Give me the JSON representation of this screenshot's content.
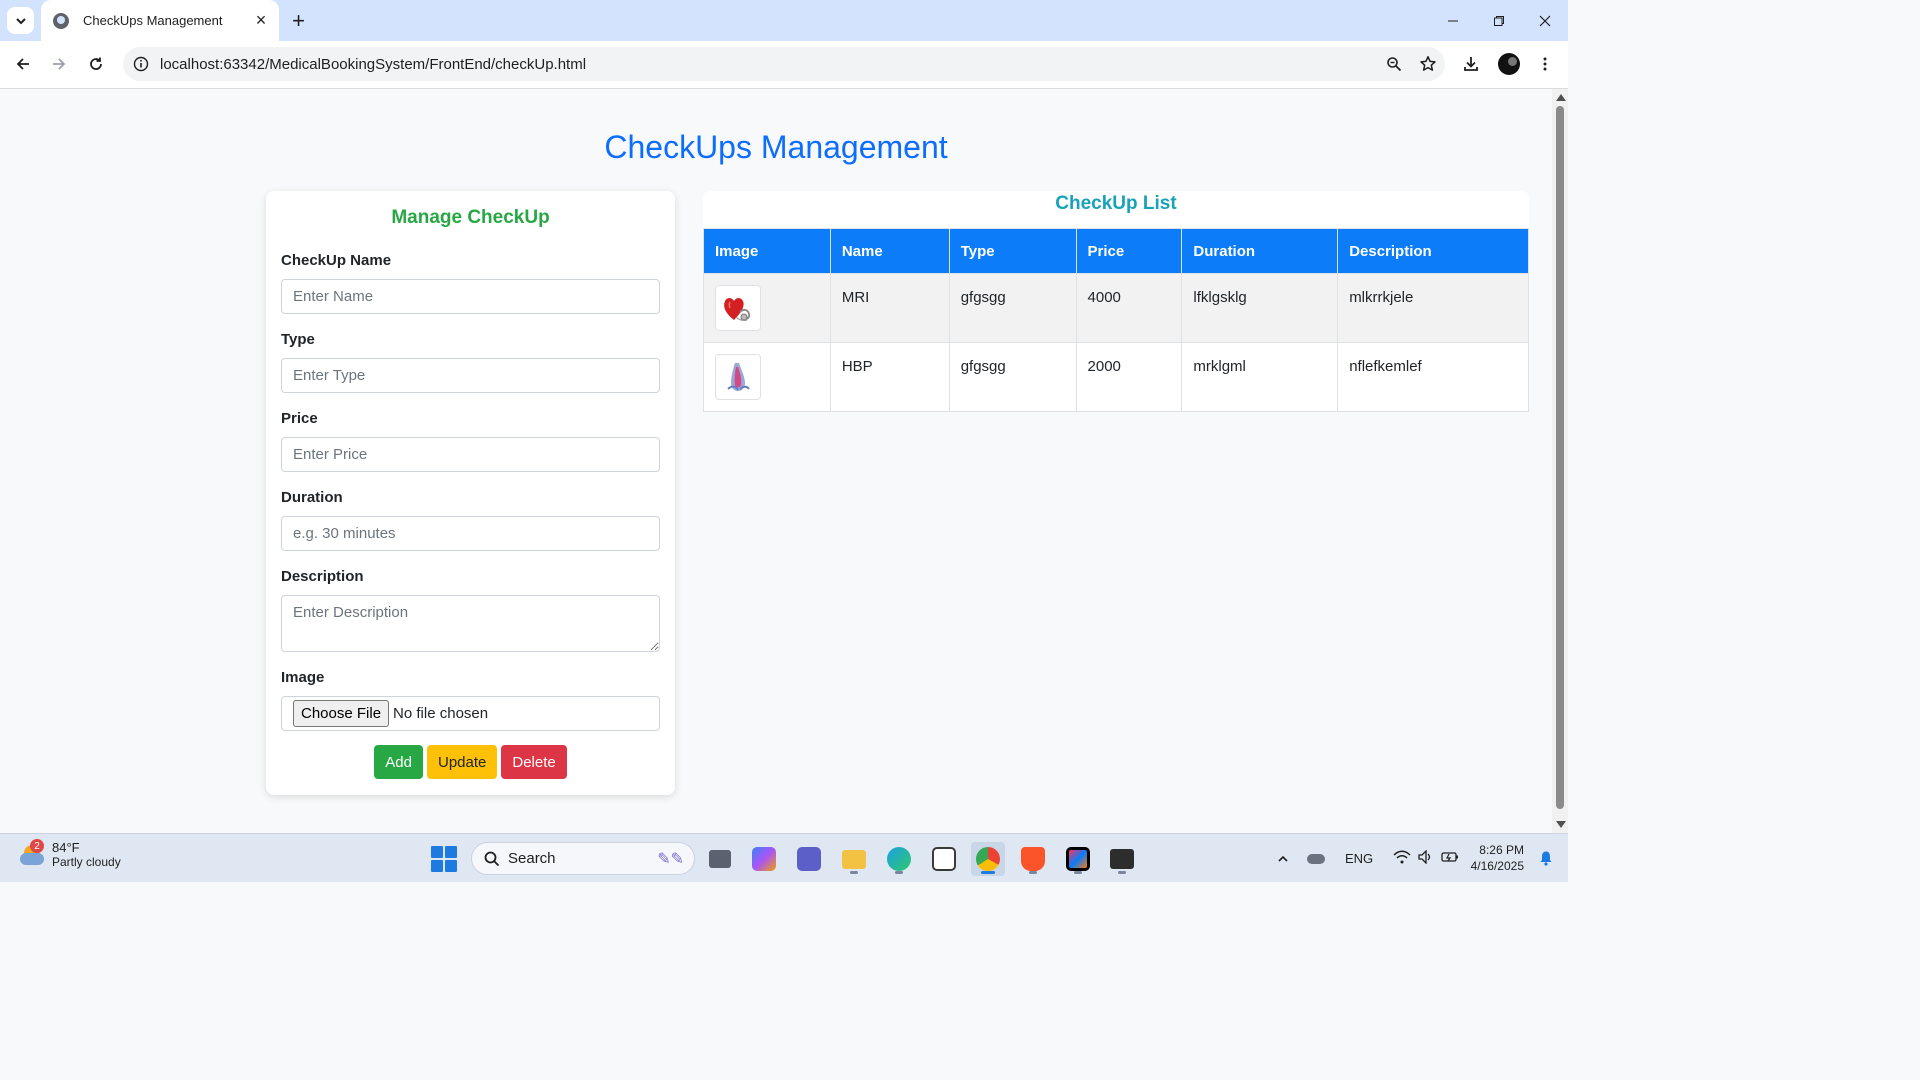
{
  "browser": {
    "tab_title": "CheckUps Management",
    "url": "localhost:63342/MedicalBookingSystem/FrontEnd/checkUp.html"
  },
  "page": {
    "title": "CheckUps Management"
  },
  "form": {
    "title": "Manage CheckUp",
    "name_label": "CheckUp Name",
    "name_placeholder": "Enter Name",
    "type_label": "Type",
    "type_placeholder": "Enter Type",
    "price_label": "Price",
    "price_placeholder": "Enter Price",
    "duration_label": "Duration",
    "duration_placeholder": "e.g. 30 minutes",
    "description_label": "Description",
    "description_placeholder": "Enter Description",
    "image_label": "Image",
    "file_button": "Choose File",
    "file_status": "No file chosen",
    "add_label": "Add",
    "update_label": "Update",
    "delete_label": "Delete"
  },
  "list": {
    "title": "CheckUp List",
    "headers": [
      "Image",
      "Name",
      "Type",
      "Price",
      "Duration",
      "Description"
    ],
    "rows": [
      {
        "image_icon": "heart-stethoscope-icon",
        "name": "MRI",
        "type": "gfgsgg",
        "price": "4000",
        "duration": "lfklgsklg",
        "description": "mlkrrkjele"
      },
      {
        "image_icon": "blood-pressure-icon",
        "name": "HBP",
        "type": "gfgsgg",
        "price": "2000",
        "duration": "mrklgml",
        "description": "nflefkemlef"
      }
    ]
  },
  "taskbar": {
    "weather_badge": "2",
    "weather_temp": "84°F",
    "weather_desc": "Partly cloudy",
    "search_label": "Search",
    "language": "ENG",
    "time": "8:26 PM",
    "date": "4/16/2025"
  },
  "colors": {
    "title_blue": "#0d6efd",
    "form_title_green": "#28a745",
    "list_title_teal": "#17a2b8",
    "table_header_blue": "#0d7cf8",
    "add_green": "#28a745",
    "update_yellow": "#ffc107",
    "delete_red": "#dc3545"
  }
}
